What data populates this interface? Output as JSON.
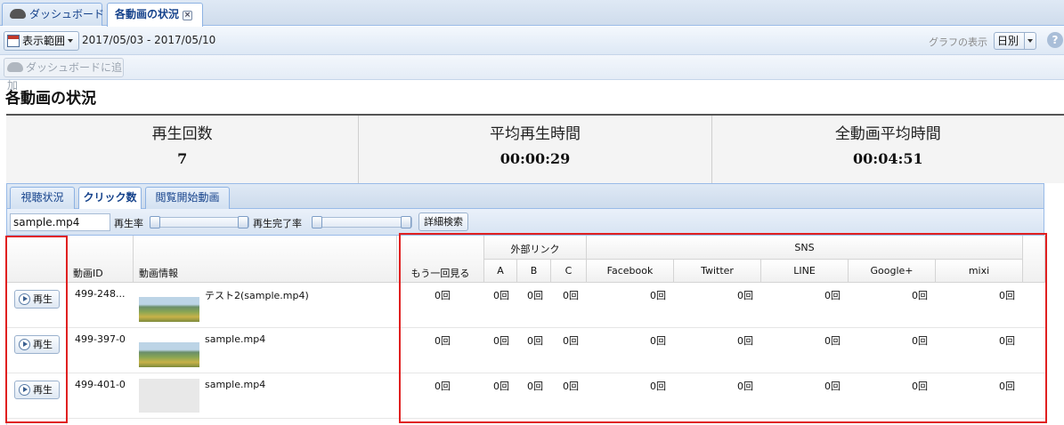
{
  "tabs": {
    "dashboard": "ダッシュボード",
    "active": "各動画の状況",
    "close_glyph": "×"
  },
  "toolbar": {
    "range_button": "表示範囲",
    "date_range": "2017/05/03 - 2017/05/10",
    "graph_label": "グラフの表示",
    "graph_value": "日別",
    "help_glyph": "?",
    "add_dashboard": "ダッシュボードに追加"
  },
  "page": {
    "title": "各動画の状況"
  },
  "stats": [
    {
      "label": "再生回数",
      "value": "7"
    },
    {
      "label": "平均再生時間",
      "value": "00:00:29"
    },
    {
      "label": "全動画平均時間",
      "value": "00:04:51"
    }
  ],
  "subtabs": [
    "視聴状況",
    "クリック数",
    "閲覧開始動画"
  ],
  "active_subtab": 1,
  "filter": {
    "filename": "sample.mp4",
    "play_rate_label": "再生率",
    "complete_rate_label": "再生完了率",
    "detail_search": "詳細検索"
  },
  "grid": {
    "headers": {
      "video_id": "動画ID",
      "video_info": "動画情報",
      "watch_again": "もう一回見る",
      "external_links": "外部リンク",
      "a": "A",
      "b": "B",
      "c": "C",
      "sns": "SNS",
      "facebook": "Facebook",
      "twitter": "Twitter",
      "line": "LINE",
      "googleplus": "Google+",
      "mixi": "mixi"
    },
    "play_label": "再生",
    "rows": [
      {
        "id": "499-248...",
        "info": "テスト2(sample.mp4)",
        "thumb": true,
        "values": [
          "0回",
          "0回",
          "0回",
          "0回",
          "0回",
          "0回",
          "0回",
          "0回",
          "0回"
        ]
      },
      {
        "id": "499-397-0",
        "info": "sample.mp4",
        "thumb": true,
        "values": [
          "0回",
          "0回",
          "0回",
          "0回",
          "0回",
          "0回",
          "0回",
          "0回",
          "0回"
        ]
      },
      {
        "id": "499-401-0",
        "info": "sample.mp4",
        "thumb": false,
        "values": [
          "0回",
          "0回",
          "0回",
          "0回",
          "0回",
          "0回",
          "0回",
          "0回",
          "0回"
        ]
      }
    ]
  },
  "colors": {
    "highlight_box": "#e02020",
    "tab_text": "#15428b"
  }
}
